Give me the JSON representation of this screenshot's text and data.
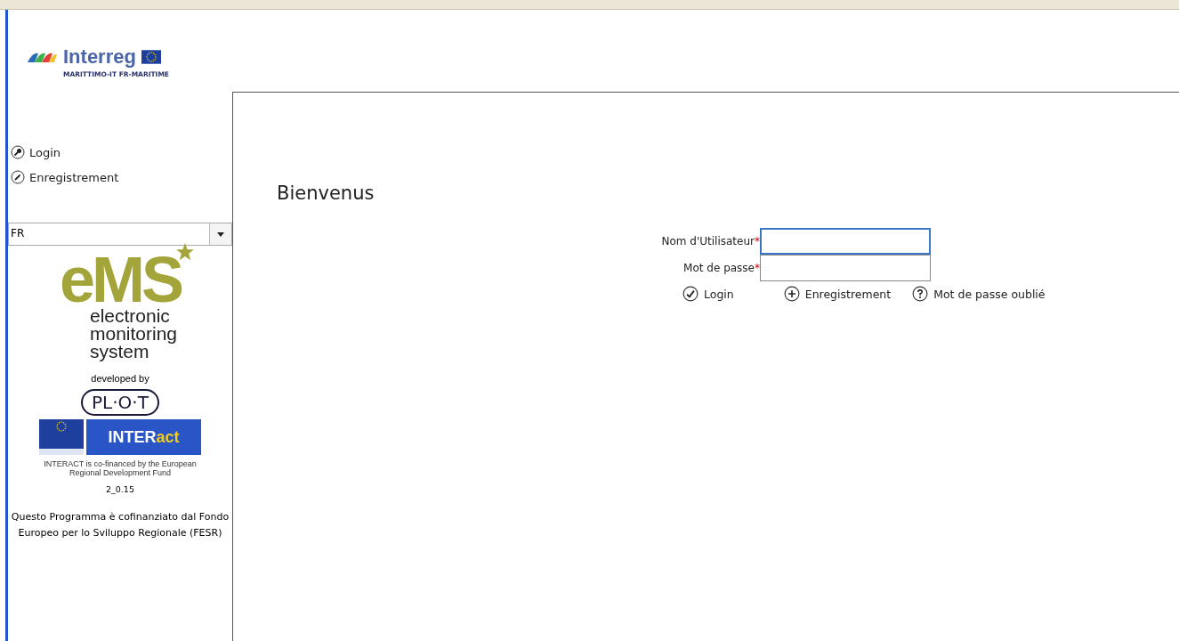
{
  "header": {
    "logo": {
      "name": "Interreg",
      "subtitle": "MARITTIMO-IT FR-MARITIME"
    }
  },
  "sidebar": {
    "items": [
      {
        "label": "Login"
      },
      {
        "label": "Enregistrement"
      }
    ],
    "language": {
      "value": "FR"
    },
    "ems_logo": {
      "mark": "eMS",
      "lines": [
        "electronic",
        "monitoring",
        "system"
      ]
    },
    "developed_by": "developed by",
    "plot_logo": "PL·O·T",
    "interact_logo": {
      "name_start": "INTER",
      "name_end": "act"
    },
    "interact_note": "INTERACT is co-financed by the European Regional Development Fund",
    "version": "2_0.15",
    "footer": "Questo Programma è cofinanziato dal Fondo Europeo per lo Sviluppo Regionale (FESR)"
  },
  "main": {
    "heading": "Bienvenus",
    "fields": [
      {
        "label": "Nom d'Utilisateur",
        "required_marker": "*",
        "focused": true
      },
      {
        "label": "Mot de passe",
        "required_marker": "*",
        "focused": false
      }
    ],
    "actions": [
      {
        "label": "Login"
      },
      {
        "label": "Enregistrement"
      },
      {
        "label": "Mot de passe oublié"
      }
    ]
  }
}
